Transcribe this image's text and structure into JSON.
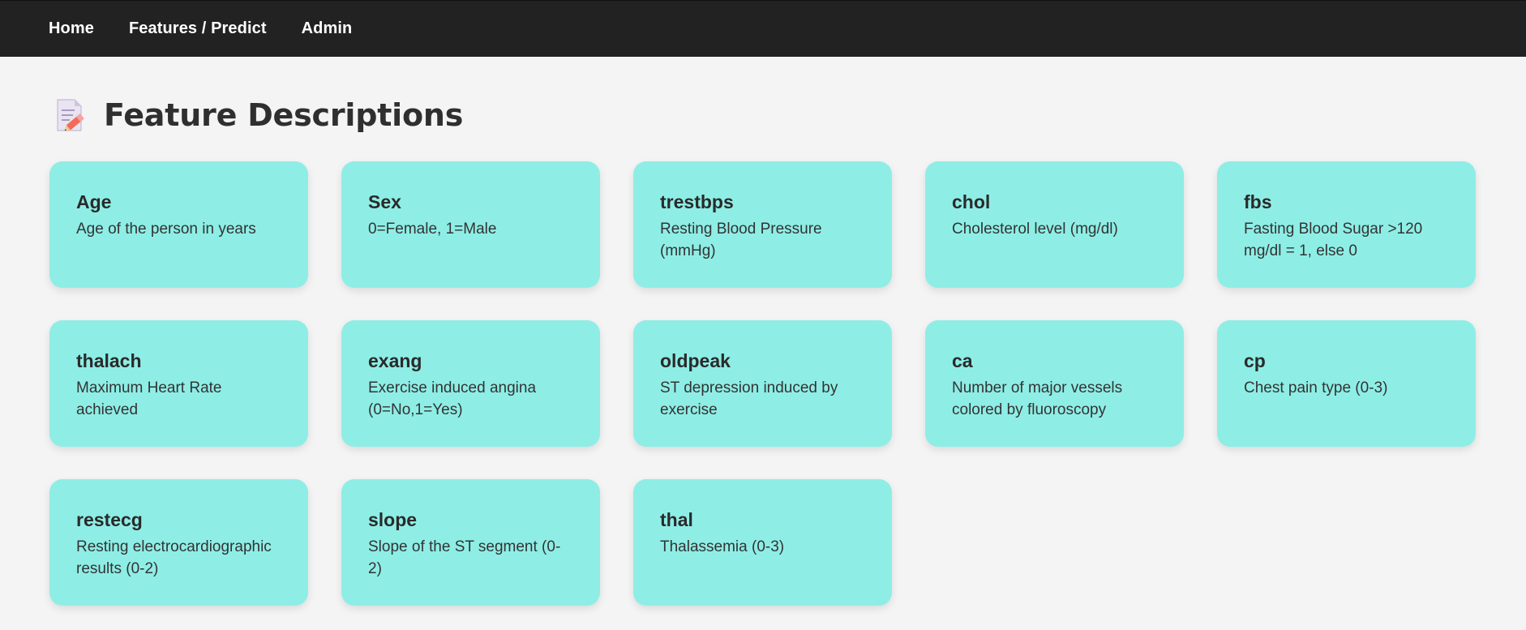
{
  "nav": {
    "items": [
      {
        "label": "Home"
      },
      {
        "label": "Features / Predict"
      },
      {
        "label": "Admin"
      }
    ]
  },
  "page": {
    "heading": "Feature Descriptions",
    "heading_icon": "memo-icon"
  },
  "features": [
    {
      "name": "Age",
      "description": "Age of the person in years"
    },
    {
      "name": "Sex",
      "description": "0=Female, 1=Male"
    },
    {
      "name": "trestbps",
      "description": "Resting Blood Pressure (mmHg)"
    },
    {
      "name": "chol",
      "description": "Cholesterol level (mg/dl)"
    },
    {
      "name": "fbs",
      "description": "Fasting Blood Sugar >120 mg/dl = 1, else 0"
    },
    {
      "name": "thalach",
      "description": "Maximum Heart Rate achieved"
    },
    {
      "name": "exang",
      "description": "Exercise induced angina (0=No,1=Yes)"
    },
    {
      "name": "oldpeak",
      "description": "ST depression induced by exercise"
    },
    {
      "name": "ca",
      "description": "Number of major vessels colored by fluoroscopy"
    },
    {
      "name": "cp",
      "description": "Chest pain type (0-3)"
    },
    {
      "name": "restecg",
      "description": "Resting electrocardiographic results (0-2)"
    },
    {
      "name": "slope",
      "description": "Slope of the ST segment (0-2)"
    },
    {
      "name": "thal",
      "description": "Thalassemia (0-3)"
    }
  ],
  "colors": {
    "nav_background": "#222222",
    "card_background": "#8eeee6",
    "page_background": "#f4f4f4"
  }
}
